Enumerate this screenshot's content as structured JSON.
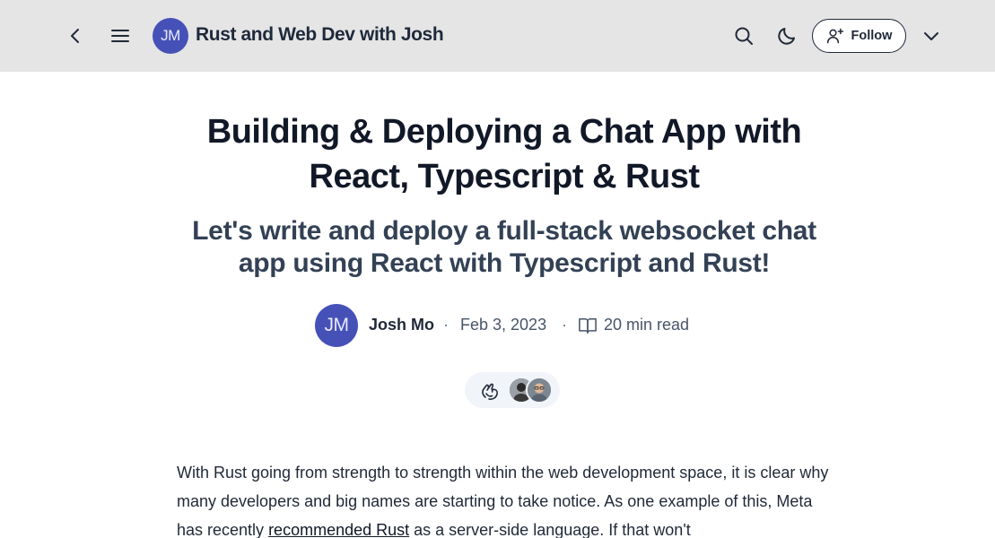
{
  "header": {
    "blog_initials": "JM",
    "blog_title": "Rust and Web Dev with Josh",
    "follow_label": "Follow",
    "icons": [
      "back-icon",
      "menu-icon",
      "search-icon",
      "moon-icon",
      "add-user-icon",
      "chevron-down-icon"
    ]
  },
  "article": {
    "title": "Building & Deploying a Chat App with React, Typescript & Rust",
    "subtitle": "Let's write and deploy a full-stack websocket chat app using React with Typescript and Rust!",
    "author_initials": "JM",
    "author": "Josh Mo",
    "separator": "·",
    "date": "Feb 3, 2023",
    "read_time": "20 min read",
    "body_part1": "With Rust going from strength to strength within the web development space, it is clear why many developers and big names are starting to take notice. As one example of this, Meta has recently ",
    "body_link": "recommended Rust",
    "body_part2": " as a server-side language. If that won't"
  },
  "colors": {
    "topbar_bg": "#e5e5e5",
    "avatar_bg": "#4651b8",
    "title": "#111827",
    "subtitle": "#334155"
  }
}
